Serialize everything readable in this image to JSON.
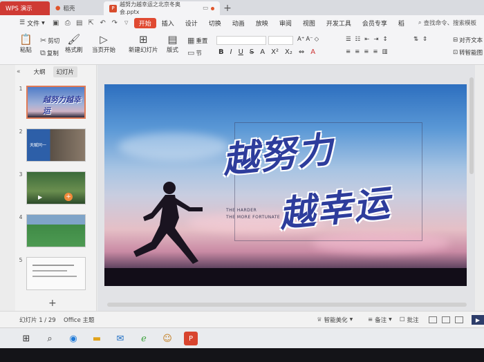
{
  "tabs": [
    {
      "label": "WPS 演示"
    },
    {
      "label": "稻壳"
    },
    {
      "label": "越努力越幸运之北京冬奥会.pptx",
      "badge": "P"
    }
  ],
  "menu": {
    "file": "文件",
    "items": [
      "开始",
      "插入",
      "设计",
      "切换",
      "动画",
      "放映",
      "审阅",
      "视图",
      "开发工具",
      "会员专享",
      "稻"
    ],
    "search": "查找命令、搜索模板"
  },
  "ribbon": {
    "paste": "粘贴",
    "cut": "剪切",
    "copy": "复制",
    "format_painter": "格式刷",
    "play_from_current": "当页开始",
    "new_slide": "新建幻灯片",
    "layout": "版式",
    "section": "节",
    "reset": "重置",
    "font_size": "0",
    "text_box_right": "对齐文本",
    "convert": "转智能图"
  },
  "left_panel": {
    "tab_outline": "大纲",
    "tab_slides": "幻灯片",
    "slides": [
      {
        "num": "1",
        "caption": "越努力越幸运"
      },
      {
        "num": "2",
        "caption": "天赋同一"
      },
      {
        "num": "3",
        "caption": ""
      },
      {
        "num": "4",
        "caption": ""
      },
      {
        "num": "5",
        "caption": ""
      }
    ],
    "add": "+"
  },
  "slide": {
    "slogan_line1": "越努力",
    "slogan_line2": "越幸运",
    "tagline_1": "THE HARDER",
    "tagline_2": "THE MORE FORTUNATE"
  },
  "status": {
    "slide_count": "幻灯片 1 / 29",
    "theme": "Office 主题",
    "smart_beautify": "智能美化",
    "notes": "备注",
    "comments": "批注"
  },
  "colors": {
    "accent": "#e04a32",
    "slogan": "#2e3d9c"
  }
}
